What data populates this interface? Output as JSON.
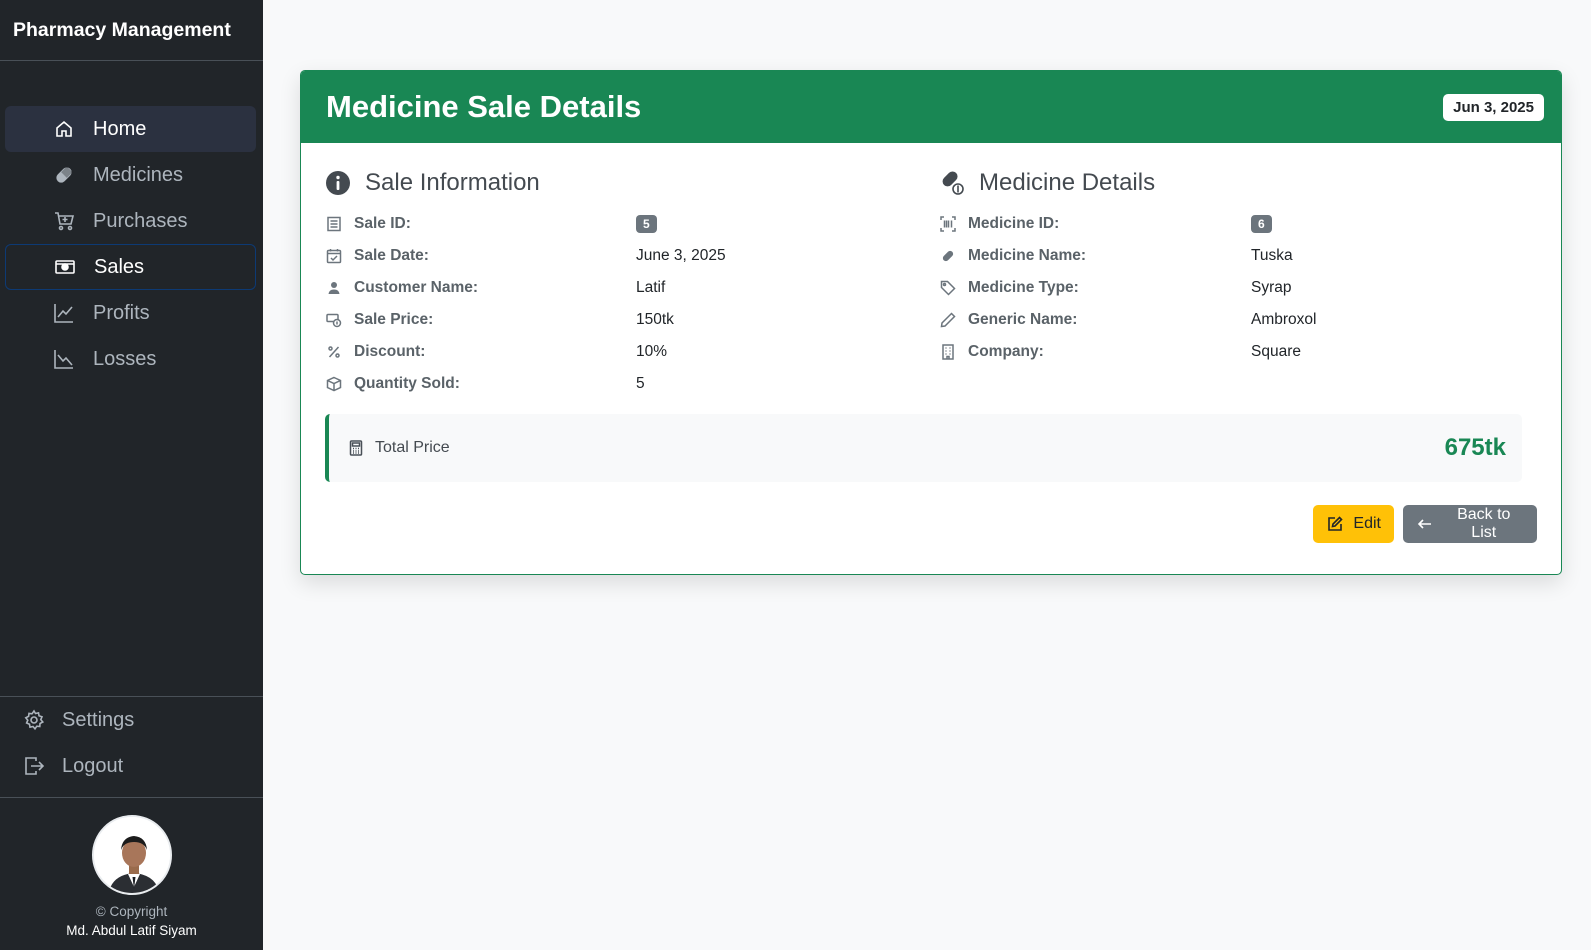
{
  "sidebar": {
    "brand": "Pharmacy Management",
    "items": [
      {
        "label": "Home",
        "icon": "home-icon"
      },
      {
        "label": "Medicines",
        "icon": "capsule-icon"
      },
      {
        "label": "Purchases",
        "icon": "cart-icon"
      },
      {
        "label": "Sales",
        "icon": "cash-icon"
      },
      {
        "label": "Profits",
        "icon": "graph-up-icon"
      },
      {
        "label": "Losses",
        "icon": "graph-down-icon"
      }
    ],
    "bottom": [
      {
        "label": "Settings",
        "icon": "gear-icon"
      },
      {
        "label": "Logout",
        "icon": "logout-icon"
      }
    ],
    "copyright": "© Copyright",
    "author": "Md. Abdul Latif Siyam"
  },
  "card": {
    "title": "Medicine Sale Details",
    "date_badge": "Jun 3, 2025",
    "accent_color": "#198754"
  },
  "sale_info": {
    "title": "Sale Information",
    "rows": [
      {
        "label": "Sale ID:",
        "value": "5"
      },
      {
        "label": "Sale Date:",
        "value": "June 3, 2025"
      },
      {
        "label": "Customer Name:",
        "value": "Latif"
      },
      {
        "label": "Sale Price:",
        "value": "150tk"
      },
      {
        "label": "Discount:",
        "value": "10%"
      },
      {
        "label": "Quantity Sold:",
        "value": "5"
      }
    ]
  },
  "medicine_details": {
    "title": "Medicine Details",
    "rows": [
      {
        "label": "Medicine ID:",
        "value": "6"
      },
      {
        "label": "Medicine Name:",
        "value": "Tuska"
      },
      {
        "label": "Medicine Type:",
        "value": "Syrap"
      },
      {
        "label": "Generic Name:",
        "value": "Ambroxol"
      },
      {
        "label": "Company:",
        "value": "Square"
      }
    ]
  },
  "total": {
    "label": "Total Price",
    "value": "675tk"
  },
  "actions": {
    "edit_label": "Edit",
    "back_label": "Back to List"
  }
}
